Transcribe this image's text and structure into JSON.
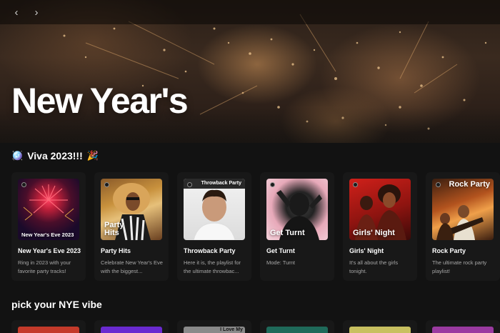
{
  "nav": {
    "back_icon": "‹",
    "forward_icon": "›"
  },
  "hero": {
    "title": "New Year's"
  },
  "sections": [
    {
      "title": "Viva 2023!!!",
      "leading_emoji": "🪩",
      "trailing_emoji": "🎉",
      "cards": [
        {
          "title": "New Year's Eve 2023",
          "desc": "Ring in 2023 with your favorite party tracks!",
          "cover_text": "New Year's Eve 2023"
        },
        {
          "title": "Party Hits",
          "desc": "Celebrate New Year's Eve with the biggest...",
          "cover_text": "Party Hits"
        },
        {
          "title": "Throwback Party",
          "desc": "Here it is, the playlist for the ultimate throwbac...",
          "cover_text": "Throwback Party"
        },
        {
          "title": "Get Turnt",
          "desc": "Mode: Turnt",
          "cover_text": "Get Turnt"
        },
        {
          "title": "Girls' Night",
          "desc": "It's all about the girls tonight.",
          "cover_text": "Girls' Night"
        },
        {
          "title": "Rock Party",
          "desc": "The ultimate rock party playlist!",
          "cover_text": "Rock Party"
        }
      ]
    },
    {
      "title": "pick your NYE vibe",
      "peek_cover_text": "I Love My"
    }
  ],
  "colors": {
    "background": "#121212",
    "card": "#181818",
    "muted_text": "#a7a7a7"
  }
}
